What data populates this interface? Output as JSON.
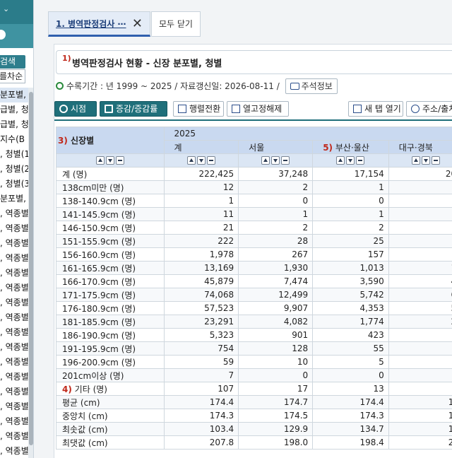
{
  "sidebar": {
    "search_label": "검색",
    "sort_label": "를차순",
    "items": [
      "분포별, 청",
      "급별, 청",
      "급별, 청",
      "지수(B",
      ", 청별(1",
      ", 청별(2",
      ", 청별(3",
      "분포별, 청",
      ", 역종별",
      ", 역종별",
      ", 역종별",
      ", 역종별",
      ", 역종별",
      ", 역종별",
      ", 역종별",
      ", 역종별",
      ", 역종별",
      ", 역종별",
      ", 역종별",
      ", 역종별",
      ", 역종별",
      ", 역종별",
      ", 역종별",
      ", 역종별",
      ", 역종별",
      ", 역종별"
    ]
  },
  "tabs": {
    "tab1_label": "1. 병역판정검사 ⋯",
    "close_all": "모두 닫기"
  },
  "title": {
    "number": "1)",
    "text": "병역판정검사 현황 - 신장 분포별, 청별"
  },
  "info": {
    "period": "수록기간 : 년 1999 ~ 2025 / 자료갱신일: 2026-08-11 /",
    "annotation_btn": "주석정보"
  },
  "toolbar": {
    "time": "시점",
    "change": "증감/증감률",
    "pivot": "행렬전환",
    "col_fix": "열고정해제",
    "new_tab": "새 탭 열기",
    "address": "주소/출처"
  },
  "table": {
    "row_header_num": "3)",
    "row_header": "신장별",
    "year": "2025",
    "columns": [
      {
        "num": "",
        "label": "계"
      },
      {
        "num": "",
        "label": "서울"
      },
      {
        "num": "5)",
        "label": "부산·울산"
      },
      {
        "num": "",
        "label": "대구·경북"
      }
    ],
    "rows": [
      {
        "num": "",
        "label": "계 (명)",
        "v": [
          "222,425",
          "37,248",
          "17,154",
          "20,"
        ]
      },
      {
        "num": "",
        "label": "138cm미만 (명)",
        "v": [
          "12",
          "2",
          "1",
          ""
        ]
      },
      {
        "num": "",
        "label": "138-140.9cm (명)",
        "v": [
          "1",
          "0",
          "0",
          ""
        ]
      },
      {
        "num": "",
        "label": "141-145.9cm (명)",
        "v": [
          "11",
          "1",
          "1",
          ""
        ]
      },
      {
        "num": "",
        "label": "146-150.9cm (명)",
        "v": [
          "21",
          "2",
          "2",
          ""
        ]
      },
      {
        "num": "",
        "label": "151-155.9cm (명)",
        "v": [
          "222",
          "28",
          "25",
          ""
        ]
      },
      {
        "num": "",
        "label": "156-160.9cm (명)",
        "v": [
          "1,978",
          "267",
          "157",
          ""
        ]
      },
      {
        "num": "",
        "label": "161-165.9cm (명)",
        "v": [
          "13,169",
          "1,930",
          "1,013",
          "1,"
        ]
      },
      {
        "num": "",
        "label": "166-170.9cm (명)",
        "v": [
          "45,879",
          "7,474",
          "3,590",
          "4,"
        ]
      },
      {
        "num": "",
        "label": "171-175.9cm (명)",
        "v": [
          "74,068",
          "12,499",
          "5,742",
          "6,"
        ]
      },
      {
        "num": "",
        "label": "176-180.9cm (명)",
        "v": [
          "57,523",
          "9,907",
          "4,353",
          "5,"
        ]
      },
      {
        "num": "",
        "label": "181-185.9cm (명)",
        "v": [
          "23,291",
          "4,082",
          "1,774",
          "2,"
        ]
      },
      {
        "num": "",
        "label": "186-190.9cm (명)",
        "v": [
          "5,323",
          "901",
          "423",
          ""
        ]
      },
      {
        "num": "",
        "label": "191-195.9cm (명)",
        "v": [
          "754",
          "128",
          "55",
          ""
        ]
      },
      {
        "num": "",
        "label": "196-200.9cm (명)",
        "v": [
          "59",
          "10",
          "5",
          ""
        ]
      },
      {
        "num": "",
        "label": "201cm이상 (명)",
        "v": [
          "7",
          "0",
          "0",
          ""
        ]
      },
      {
        "num": "4)",
        "label": "기타 (명)",
        "v": [
          "107",
          "17",
          "13",
          ""
        ]
      },
      {
        "num": "",
        "label": "평균 (cm)",
        "v": [
          "174.4",
          "174.7",
          "174.4",
          "17"
        ]
      },
      {
        "num": "",
        "label": "중앙치 (cm)",
        "v": [
          "174.3",
          "174.5",
          "174.3",
          "17"
        ]
      },
      {
        "num": "",
        "label": "최솟값 (cm)",
        "v": [
          "103.4",
          "129.9",
          "134.7",
          "13"
        ]
      },
      {
        "num": "",
        "label": "최댓값 (cm)",
        "v": [
          "207.8",
          "198.0",
          "198.4",
          "20"
        ]
      }
    ]
  }
}
